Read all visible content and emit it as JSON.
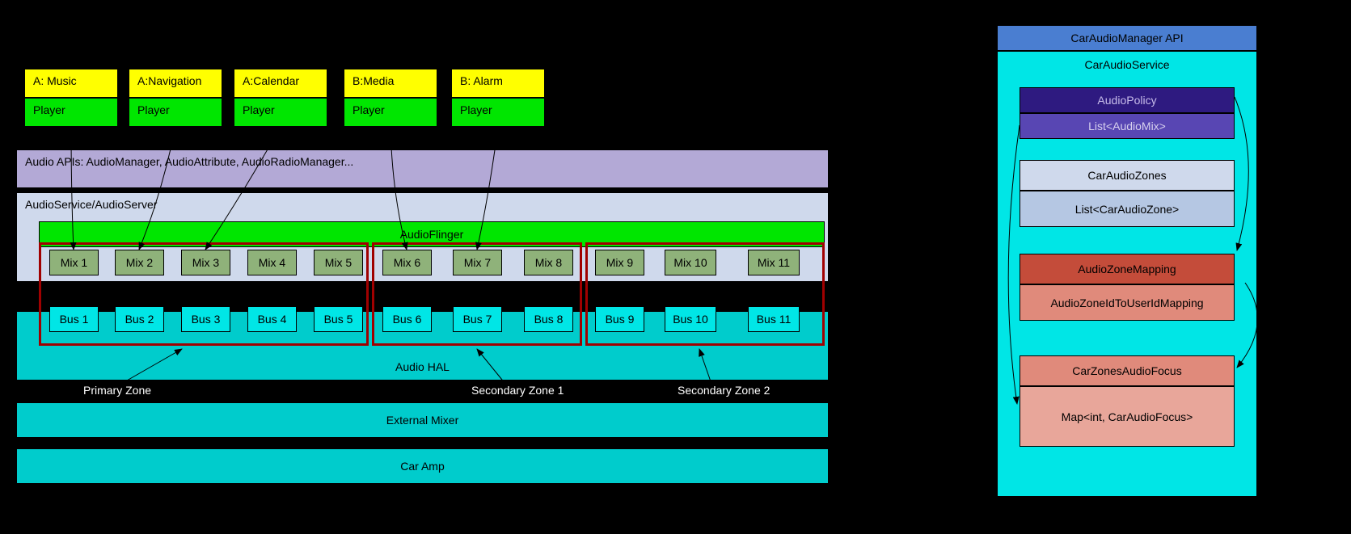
{
  "sources": [
    {
      "app": "A: Music",
      "player": "Player"
    },
    {
      "app": "A:Navigation",
      "player": "Player"
    },
    {
      "app": "A:Calendar",
      "player": "Player"
    },
    {
      "app": "B:Media",
      "player": "Player"
    },
    {
      "app": "B: Alarm",
      "player": "Player"
    }
  ],
  "audioApis": "Audio APIs: AudioManager, AudioAttribute, AudioRadioManager...",
  "audioService": "AudioService/AudioServer",
  "audioFlinger": "AudioFlinger",
  "mixes": [
    "Mix 1",
    "Mix 2",
    "Mix 3",
    "Mix 4",
    "Mix 5",
    "Mix 6",
    "Mix 7",
    "Mix 8",
    "Mix 9",
    "Mix 10",
    "Mix 11"
  ],
  "buses": [
    "Bus 1",
    "Bus 2",
    "Bus 3",
    "Bus 4",
    "Bus 5",
    "Bus 6",
    "Bus 7",
    "Bus 8",
    "Bus 9",
    "Bus 10",
    "Bus 11"
  ],
  "audioHal": "Audio HAL",
  "externalMixer": "External Mixer",
  "carAmp": "Car Amp",
  "zoneLabels": {
    "primary": "Primary Zone",
    "secondary1": "Secondary Zone 1",
    "secondary2": "Secondary Zone 2"
  },
  "rightPanel": {
    "api": "CarAudioManager API",
    "service": "CarAudioService",
    "audioPolicy": "AudioPolicy",
    "audioMixList": "List<AudioMix>",
    "carAudioZones": "CarAudioZones",
    "carAudioZoneList": "List<CarAudioZone>",
    "audioZoneMapping": "AudioZoneMapping",
    "zoneUserMapping": "AudioZoneIdToUserIdMapping",
    "zonesFocus": "CarZonesAudioFocus",
    "focusMap": "Map<int, CarAudioFocus>"
  }
}
